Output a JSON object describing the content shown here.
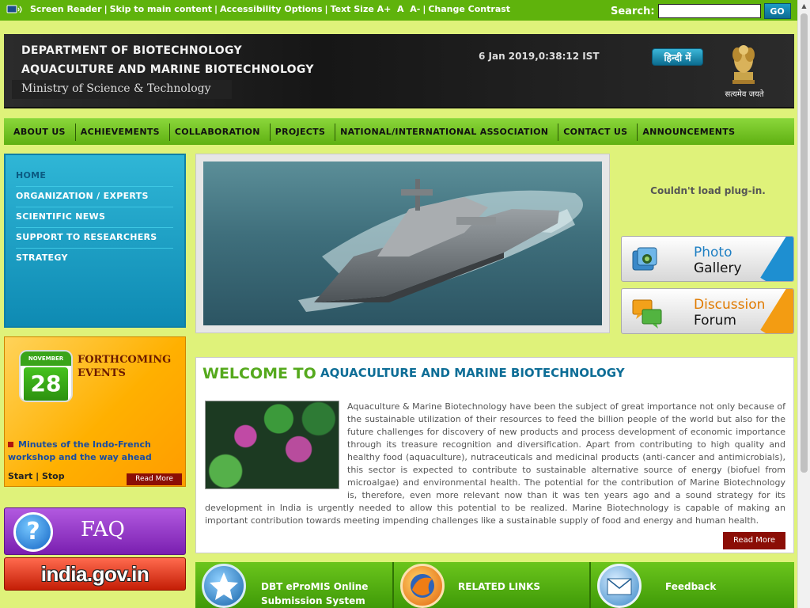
{
  "topbar": {
    "links": [
      "Screen Reader",
      "Skip to main content",
      "Accessibility Options",
      "Text Size A+",
      "A",
      "A-",
      "Change Contrast"
    ],
    "search_label": "Search:",
    "search_value": "",
    "go_label": "GO"
  },
  "header": {
    "line1": "DEPARTMENT OF BIOTECHNOLOGY",
    "line2": "AQUACULTURE AND MARINE BIOTECHNOLOGY",
    "line3": "Ministry of Science & Technology",
    "datetime": "6 Jan 2019,0:38:12 IST",
    "hindi_label": "हिन्दी में",
    "motto": "सत्यमेव जयते"
  },
  "nav": [
    "ABOUT US",
    "ACHIEVEMENTS",
    "COLLABORATION",
    "PROJECTS",
    "NATIONAL/INTERNATIONAL ASSOCIATION",
    "CONTACT US",
    "ANNOUNCEMENTS"
  ],
  "leftmenu": [
    "HOME",
    "ORGANIZATION / EXPERTS",
    "SCIENTIFIC NEWS",
    "SUPPORT TO RESEARCHERS",
    "STRATEGY"
  ],
  "events": {
    "cal_month": "NOVEMBER",
    "cal_day": "28",
    "title": "FORTHCOMING EVENTS",
    "item": "Minutes of the Indo-French workshop and the way ahead",
    "start": "Start",
    "stop": "Stop",
    "read_more": "Read More"
  },
  "faq_label": "FAQ",
  "indiagov_label": "india.gov.in",
  "plugin_msg": "Couldn't load plug-in.",
  "photo_gallery": {
    "line1": "Photo",
    "line2": "Gallery"
  },
  "discussion_forum": {
    "line1": "Discussion",
    "line2": "Forum"
  },
  "welcome": {
    "title1": "WELCOME TO",
    "title2": "AQUACULTURE AND MARINE BIOTECHNOLOGY",
    "body": "Aquaculture & Marine Biotechnology have been the subject of great importance not only because of the sustainable utilization of their resources to feed the billion people of the world but also for the future challenges for discovery of new products and process development of economic importance through its treasure recognition and diversification. Apart from contributing to high quality and healthy food (aquaculture), nutraceuticals and medicinal products (anti-cancer and antimicrobials), this sector is expected to contribute to sustainable alternative source of energy (biofuel from microalgae) and environmental health. The potential for the contribution of Marine Biotechnology is, therefore, even more relevant now than it was ten years ago and a sound strategy for its development in India is urgently needed to allow this potential to be realized. Marine Biotechnology is capable of making an important contribution towards meeting impending challenges like a sustainable supply of food and energy and human health.",
    "read_more": "Read More"
  },
  "tiles": {
    "epromis": {
      "line1": "DBT eProMIS Online",
      "line2": "Submission System"
    },
    "related": "RELATED LINKS",
    "feedback": "Feedback"
  },
  "colors": {
    "page_bg": "#dff27a",
    "topbar": "#5fb30c",
    "nav": "#6fc21f",
    "leftmenu": "#1fa3c9",
    "accent_green": "#55a91d",
    "accent_blue": "#0d6d96",
    "read_more": "#8b0e06"
  }
}
